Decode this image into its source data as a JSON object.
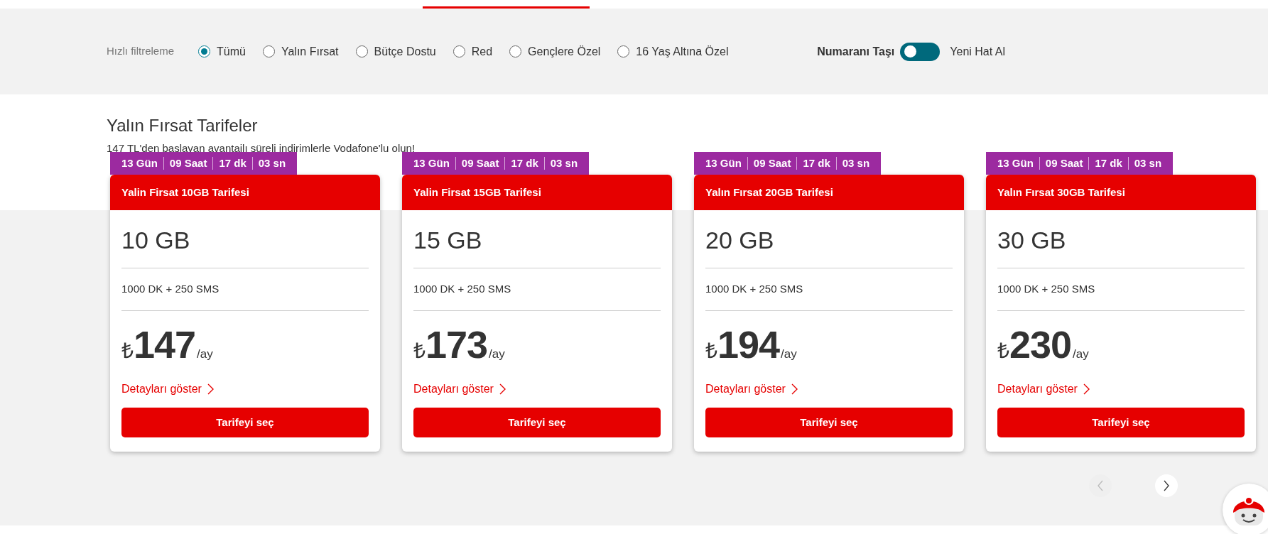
{
  "filter": {
    "label": "Hızlı filtreleme",
    "options": [
      {
        "label": "Tümü",
        "selected": true
      },
      {
        "label": "Yalın Fırsat",
        "selected": false
      },
      {
        "label": "Bütçe Dostu",
        "selected": false
      },
      {
        "label": "Red",
        "selected": false
      },
      {
        "label": "Gençlere Özel",
        "selected": false
      },
      {
        "label": "16 Yaş Altına Özel",
        "selected": false
      }
    ]
  },
  "line_toggle": {
    "left_label": "Numaranı Taşı",
    "right_label": "Yeni Hat Al",
    "on": false
  },
  "section": {
    "title": "Yalın Fırsat Tarifeler",
    "subtitle": "147 TL'den başlayan avantajlı süreli indirimlerle Vodafone'lu olun!"
  },
  "cards": [
    {
      "timer": [
        "13 Gün",
        "09 Saat",
        "17 dk",
        "03 sn"
      ],
      "name": "Yalin Firsat 10GB Tarifesi",
      "data": "10 GB",
      "allowance": "1000 DK + 250 SMS",
      "currency": "₺",
      "price": "147",
      "period": "/ay",
      "details_link": "Detayları göster",
      "button": "Tarifeyi seç"
    },
    {
      "timer": [
        "13 Gün",
        "09 Saat",
        "17 dk",
        "03 sn"
      ],
      "name": "Yalin Firsat 15GB Tarifesi",
      "data": "15 GB",
      "allowance": "1000 DK + 250 SMS",
      "currency": "₺",
      "price": "173",
      "period": "/ay",
      "details_link": "Detayları göster",
      "button": "Tarifeyi seç"
    },
    {
      "timer": [
        "13 Gün",
        "09 Saat",
        "17 dk",
        "03 sn"
      ],
      "name": "Yalın Fırsat 20GB Tarifesi",
      "data": "20 GB",
      "allowance": "1000 DK + 250 SMS",
      "currency": "₺",
      "price": "194",
      "period": "/ay",
      "details_link": "Detayları göster",
      "button": "Tarifeyi seç"
    },
    {
      "timer": [
        "13 Gün",
        "09 Saat",
        "17 dk",
        "03 sn"
      ],
      "name": "Yalın Fırsat 30GB Tarifesi",
      "data": "30 GB",
      "allowance": "1000 DK + 250 SMS",
      "currency": "₺",
      "price": "230",
      "period": "/ay",
      "details_link": "Detayları göster",
      "button": "Tarifeyi seç"
    }
  ],
  "carousel": {
    "prev_disabled": true,
    "next_disabled": false
  }
}
